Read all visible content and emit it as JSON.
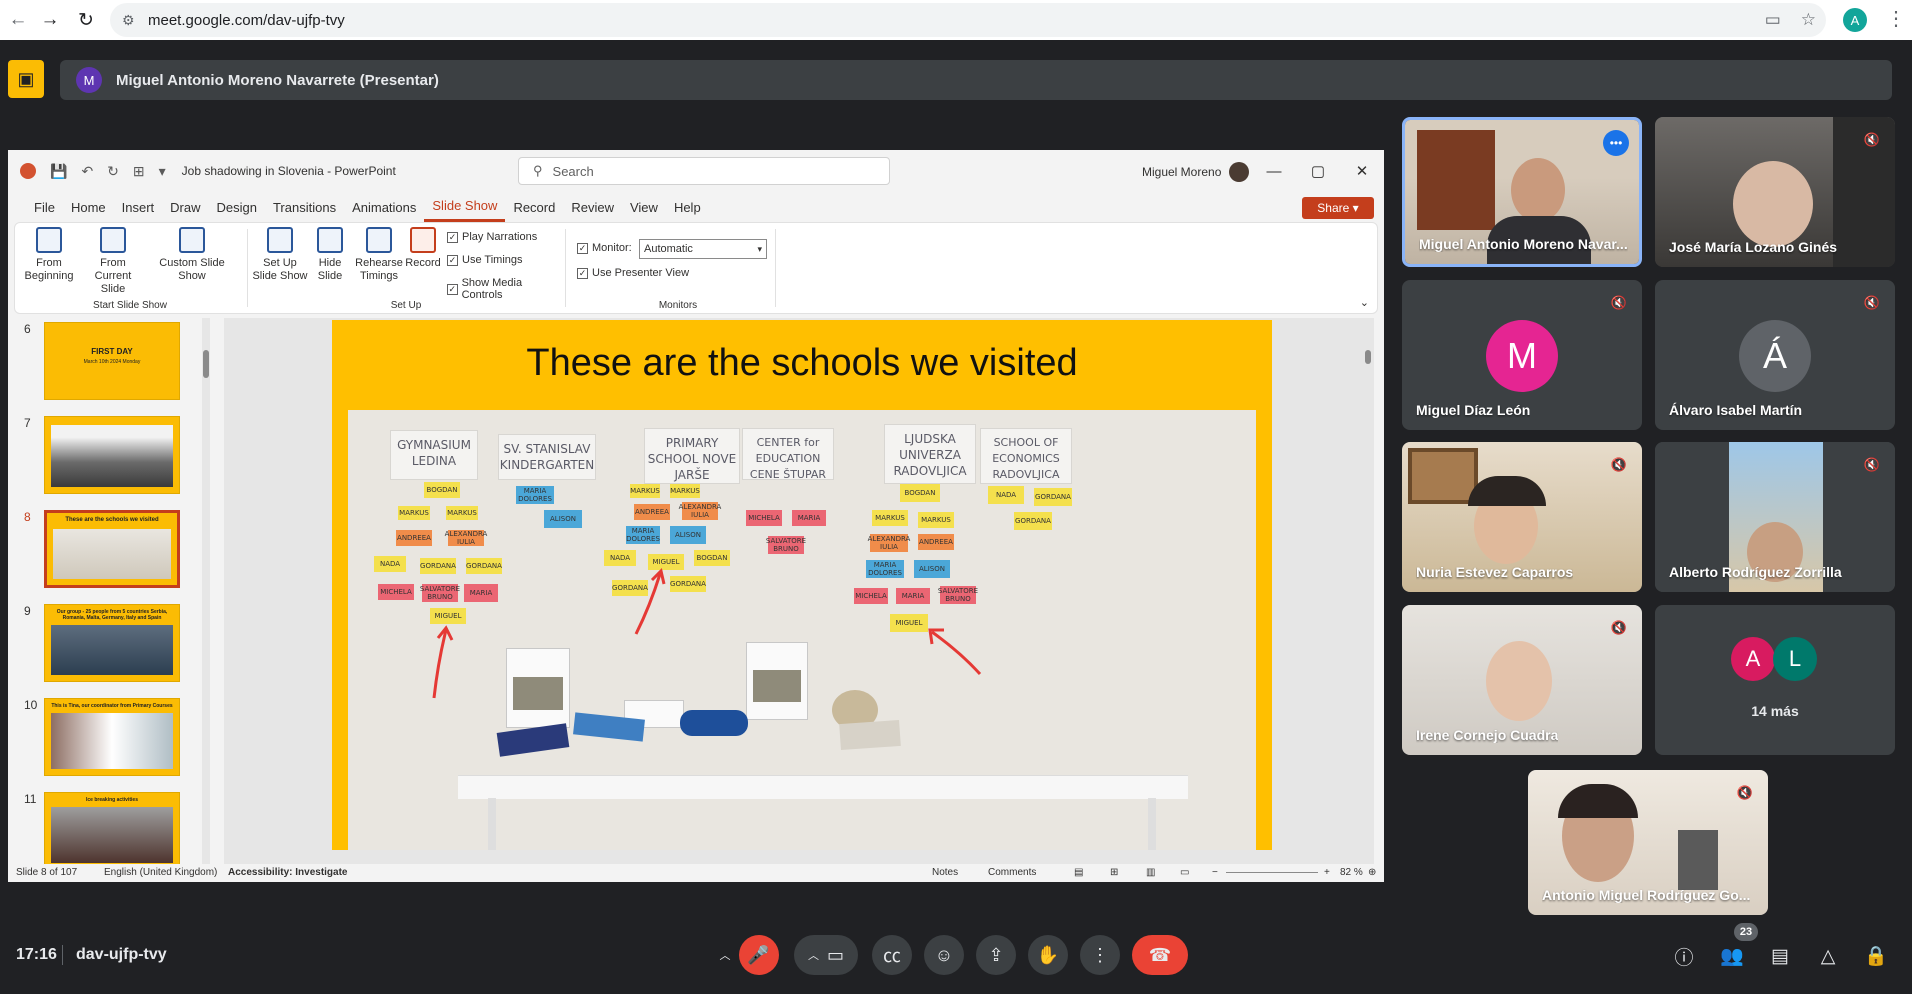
{
  "browser": {
    "url": "meet.google.com/dav-ujfp-tvy",
    "profile_initial": "A"
  },
  "presenting": {
    "avatar_initial": "M",
    "label": "Miguel Antonio Moreno Navarrete (Presentar)"
  },
  "powerpoint": {
    "document_title": "Job shadowing in Slovenia - PowerPoint",
    "search_placeholder": "Search",
    "user_name": "Miguel Moreno",
    "menu": [
      "File",
      "Home",
      "Insert",
      "Draw",
      "Design",
      "Transitions",
      "Animations",
      "Slide Show",
      "Record",
      "Review",
      "View",
      "Help"
    ],
    "active_menu": "Slide Show",
    "share_label": "Share",
    "ribbon": {
      "from_beginning": "From Beginning",
      "from_current": "From Current Slide",
      "custom_show": "Custom Slide Show",
      "start_group": "Start Slide Show",
      "setup_show": "Set Up Slide Show",
      "hide_slide": "Hide Slide",
      "rehearse": "Rehearse Timings",
      "record": "Record",
      "play_narrations": "Play Narrations",
      "use_timings": "Use Timings",
      "show_media": "Show Media Controls",
      "setup_group": "Set Up",
      "monitor_label": "Monitor:",
      "monitor_value": "Automatic",
      "presenter_view": "Use Presenter View",
      "monitors_group": "Monitors"
    },
    "thumbnails": [
      {
        "num": "6",
        "title": "FIRST DAY",
        "subtitle": "March 10th 2024 Monday"
      },
      {
        "num": "7",
        "title": ""
      },
      {
        "num": "8",
        "title": "These are the schools we visited"
      },
      {
        "num": "9",
        "title": "Our group - 25 people from 5 countries Serbia, Romania, Malta, Germany, Italy and Spain"
      },
      {
        "num": "10",
        "title": "This is Tina, our coordinator from Primary Courses"
      },
      {
        "num": "11",
        "title": "Ice breaking activities"
      }
    ],
    "slide": {
      "title": "These are the schools we visited",
      "wall_sheets": [
        "GYMNASIUM LEDINA",
        "SV. STANISLAV KINDERGARTEN",
        "PRIMARY SCHOOL NOVE JARŠE",
        "CENTER for EDUCATION CENE ŠTUPAR",
        "LJUDSKA UNIVERZA RADOVLJICA",
        "SCHOOL OF ECONOMICS RADOVLJICA"
      ],
      "postits": [
        "BOGDAN",
        "MARKUS",
        "MARKUS",
        "ANDREEA",
        "ALEXANDRA IULIA",
        "NADA",
        "GORDANA",
        "GORDANA",
        "MICHELA",
        "SALVATORE BRUNO",
        "MARIA",
        "MIGUEL",
        "MARIA DOLORES",
        "ALISON",
        "MARKUS",
        "MARKUS",
        "ANDREEA",
        "ALEXANDRA IULIA",
        "MARIA DOLORES",
        "ALISON",
        "NADA",
        "MIGUEL",
        "BOGDAN",
        "GORDANA",
        "GORDANA",
        "MICHELA",
        "MARIA",
        "SALVATORE BRUNO",
        "BOGDAN",
        "MARKUS",
        "MARKUS",
        "ALEXANDRA IULIA",
        "ANDREEA",
        "MARIA DOLORES",
        "ALISON",
        "MICHELA",
        "MARIA",
        "SALVATORE BRUNO",
        "MIGUEL",
        "NADA",
        "GORDANA",
        "GORDANA"
      ]
    },
    "status": {
      "slide_info": "Slide 8 of 107",
      "language": "English (United Kingdom)",
      "accessibility": "Accessibility: Investigate",
      "notes": "Notes",
      "comments": "Comments",
      "zoom": "82 %"
    }
  },
  "participants": [
    {
      "name": "Miguel Antonio Moreno Navar...",
      "active": true
    },
    {
      "name": "José María Lozano Ginés"
    },
    {
      "name": "Miguel Díaz León",
      "initial": "M",
      "color": "#e52592"
    },
    {
      "name": "Álvaro Isabel Martín",
      "initial": "Á",
      "color": "#5f6368"
    },
    {
      "name": "Nuria Estevez Caparros"
    },
    {
      "name": "Alberto Rodríguez Zorrilla"
    },
    {
      "name": "Irene Cornejo Cuadra"
    },
    {
      "name": "Antonio Miguel Rodríguez Go..."
    }
  ],
  "more_tile": {
    "initials": [
      "A",
      "L"
    ],
    "colors": [
      "#d81b60",
      "#00796b"
    ],
    "label": "14 más"
  },
  "bottombar": {
    "time": "17:16",
    "meeting_code": "dav-ujfp-tvy",
    "participant_count": "23"
  }
}
